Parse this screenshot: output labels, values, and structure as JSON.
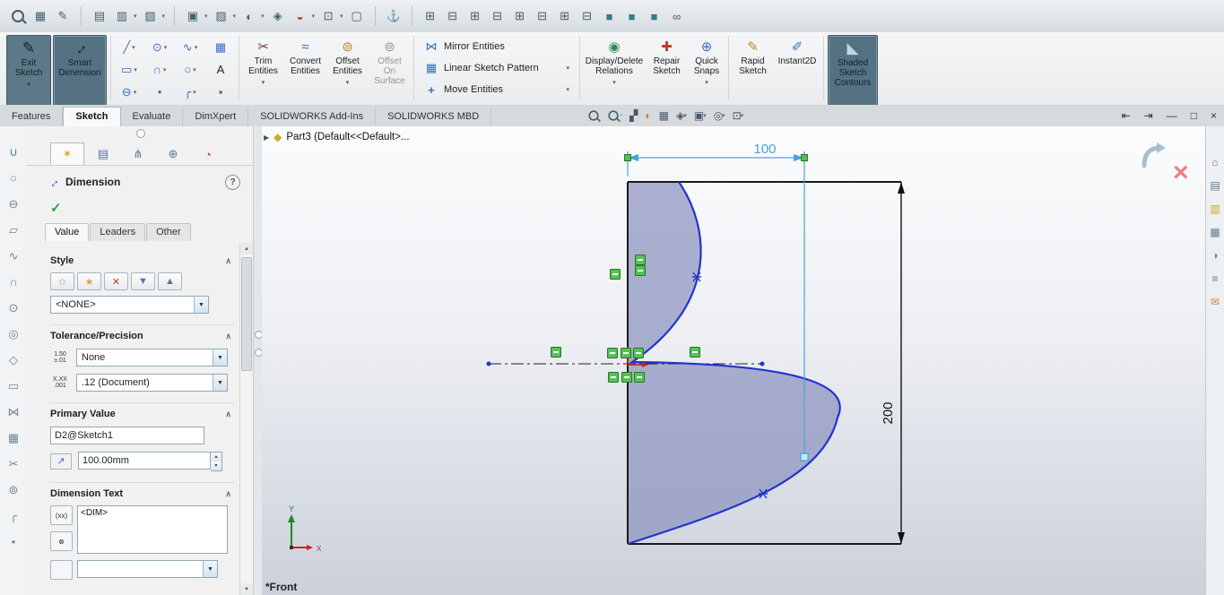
{
  "qat": {
    "icons": [
      {
        "name": "image-icon",
        "glyph": "▦"
      },
      {
        "name": "airbrush-icon",
        "glyph": "✎"
      },
      {
        "name": "stamp-icon",
        "glyph": "▤"
      },
      {
        "name": "print-icon",
        "glyph": "▥"
      },
      {
        "name": "save-icon",
        "glyph": "▧"
      },
      {
        "name": "view-cube-icon",
        "glyph": "▣"
      },
      {
        "name": "pattern-cube-icon",
        "glyph": "▨"
      },
      {
        "name": "appearance-sphere-icon",
        "glyph": "◐"
      },
      {
        "name": "scene-icon",
        "glyph": "◈"
      },
      {
        "name": "material-icon",
        "glyph": "◒"
      },
      {
        "name": "monitor-icon",
        "glyph": "⊡"
      },
      {
        "name": "wire-cube-icon",
        "glyph": "▢"
      },
      {
        "name": "anchor-icon",
        "glyph": "⚓"
      },
      {
        "name": "window-layout-1",
        "glyph": "⊞"
      },
      {
        "name": "window-layout-2",
        "glyph": "⊟"
      },
      {
        "name": "window-layout-3",
        "glyph": "⊞"
      },
      {
        "name": "window-layout-4",
        "glyph": "⊟"
      },
      {
        "name": "window-layout-5",
        "glyph": "⊞"
      },
      {
        "name": "window-layout-6",
        "glyph": "⊟"
      },
      {
        "name": "window-layout-7",
        "glyph": "⊞"
      },
      {
        "name": "window-layout-8",
        "glyph": "⊟"
      },
      {
        "name": "primitive-cube-1",
        "glyph": "■"
      },
      {
        "name": "primitive-cube-2",
        "glyph": "■"
      },
      {
        "name": "primitive-cube-3",
        "glyph": "■"
      },
      {
        "name": "attachment-icon",
        "glyph": "∞"
      }
    ]
  },
  "cmd": {
    "exit_sketch": "Exit\nSketch",
    "exit_icon": "✎",
    "smart_dimension": "Smart\nDimension",
    "smartdim_icon": "↔",
    "tools": [
      {
        "glyph": "╱"
      },
      {
        "glyph": "⊙"
      },
      {
        "glyph": "∿"
      },
      {
        "glyph": "▦"
      },
      {
        "glyph": "▭"
      },
      {
        "glyph": "∩"
      },
      {
        "glyph": "○"
      },
      {
        "glyph": "A"
      },
      {
        "glyph": "⊖"
      },
      {
        "glyph": "•"
      },
      {
        "glyph": "╭"
      },
      {
        "glyph": "▪"
      }
    ],
    "trim": "Trim\nEntities",
    "trim_icon": "✂",
    "convert": "Convert\nEntities",
    "convert_icon": "≈",
    "offset": "Offset\nEntities",
    "offset_icon": "⊚",
    "offset_surface": "Offset\nOn\nSurface",
    "offset_surface_icon": "⊚",
    "mirror": "Mirror Entities",
    "mirror_icon": "⋈",
    "linear_pattern": "Linear Sketch Pattern",
    "pattern_icon": "▦",
    "move": "Move Entities",
    "move_icon": "+",
    "display_delete": "Display/Delete\nRelations",
    "display_icon": "◉",
    "repair": "Repair\nSketch",
    "repair_icon": "✚",
    "quick_snaps": "Quick\nSnaps",
    "snaps_icon": "⊕",
    "rapid": "Rapid\nSketch",
    "rapid_icon": "✎",
    "instant2d": "Instant2D",
    "instant_icon": "✐",
    "shaded": "Shaded\nSketch\nContours",
    "shaded_icon": "◣"
  },
  "window": {
    "tabs": [
      {
        "label": "Features"
      },
      {
        "label": "Sketch"
      },
      {
        "label": "Evaluate"
      },
      {
        "label": "DimXpert"
      },
      {
        "label": "SOLIDWORKS Add-Ins"
      },
      {
        "label": "SOLIDWORKS MBD"
      }
    ],
    "controls": [
      {
        "name": "collapse-left-pane",
        "glyph": "⇤"
      },
      {
        "name": "collapse-right-pane",
        "glyph": "⇥"
      },
      {
        "name": "minimize",
        "glyph": "—"
      },
      {
        "name": "restore",
        "glyph": "□"
      },
      {
        "name": "close",
        "glyph": "×"
      }
    ]
  },
  "headsup": {
    "icons": [
      {
        "name": "zoom-fit-icon",
        "glyph": ""
      },
      {
        "name": "zoom-area-icon",
        "glyph": ""
      },
      {
        "name": "section-view-icon",
        "glyph": "▞"
      },
      {
        "name": "edit-appearance-icon",
        "glyph": "◐"
      },
      {
        "name": "apply-scene-icon",
        "glyph": "▦"
      },
      {
        "name": "display-style-icon",
        "glyph": "◈",
        "dd": "▾"
      },
      {
        "name": "view-orientation-icon",
        "glyph": "▣",
        "dd": "▾"
      },
      {
        "name": "hide-show-icon",
        "glyph": "◎",
        "dd": "▾"
      },
      {
        "name": "view-settings-icon",
        "glyph": "⊡",
        "dd": "▾"
      }
    ]
  },
  "tree": {
    "root": "Part3 (Default<<Default>...",
    "expander": "▶",
    "icon": "◆"
  },
  "pm": {
    "title": "Dimension",
    "help": "?",
    "ok": "✓",
    "tab_icons": [
      {
        "name": "propertymanager-tab",
        "glyph": "✶"
      },
      {
        "name": "custom-pane-tab",
        "glyph": "▤"
      },
      {
        "name": "tree-pane-tab",
        "glyph": "⋔"
      },
      {
        "name": "dimxpert-pane-tab",
        "glyph": "⊕"
      },
      {
        "name": "display-pane-tab",
        "glyph": "◔"
      }
    ],
    "tabs": [
      {
        "label": "Value"
      },
      {
        "label": "Leaders"
      },
      {
        "label": "Other"
      }
    ],
    "chevron": "∧",
    "style": {
      "header": "Style",
      "value": "<NONE>",
      "buttons": [
        {
          "name": "no-style-button",
          "glyph": "☆"
        },
        {
          "name": "add-style-button",
          "glyph": "★"
        },
        {
          "name": "delete-style-button",
          "glyph": "✕"
        },
        {
          "name": "save-style-button",
          "glyph": "▼"
        },
        {
          "name": "load-style-button",
          "glyph": "▲"
        }
      ]
    },
    "tolerance": {
      "header": "Tolerance/Precision",
      "type": "None",
      "precision": ".12 (Document)",
      "tol_icon": "1.50\n±.01",
      "prec_icon": "X.XX\n.001"
    },
    "primary": {
      "header": "Primary Value",
      "name": "D2@Sketch1",
      "value": "100.00mm",
      "override_icon": "↗"
    },
    "dim_text": {
      "header": "Dimension Text",
      "value": "<DIM>",
      "icon1": "(xx)",
      "icon2": "⊗"
    }
  },
  "viewport": {
    "dim_width": "100",
    "dim_height": "200",
    "view_label": "*Front",
    "triad": {
      "x": "X",
      "y": "Y"
    }
  },
  "left_toolbar": {
    "icons": [
      {
        "name": "magnet-tool-icon",
        "glyph": "∪"
      },
      {
        "name": "circle-tool-icon",
        "glyph": "○"
      },
      {
        "name": "ellipse-tool-icon",
        "glyph": "⊖"
      },
      {
        "name": "parallelogram-tool-icon",
        "glyph": "▱"
      },
      {
        "name": "spline-tool-icon",
        "glyph": "∿"
      },
      {
        "name": "arc-tool-icon",
        "glyph": "∩"
      },
      {
        "name": "perimeter-circle-icon",
        "glyph": "⊙"
      },
      {
        "name": "ring-tool-icon",
        "glyph": "◎"
      },
      {
        "name": "polygon-tool-icon",
        "glyph": "◇"
      },
      {
        "name": "rectangle-tool-icon",
        "glyph": "▭"
      },
      {
        "name": "mirror-tool-icon",
        "glyph": "⋈"
      },
      {
        "name": "pattern-tool-icon",
        "glyph": "▦"
      },
      {
        "name": "trim-tool-icon",
        "glyph": "✂"
      },
      {
        "name": "offset-tool-icon",
        "glyph": "⊚"
      },
      {
        "name": "fillet-tool-icon",
        "glyph": "╭"
      },
      {
        "name": "point-tool-icon",
        "glyph": "•"
      }
    ]
  },
  "taskpane": {
    "icons": [
      {
        "name": "home-icon",
        "glyph": "⌂",
        "color": "#b06040"
      },
      {
        "name": "design-library-icon",
        "glyph": "▤",
        "color": "#5b7a94"
      },
      {
        "name": "file-explorer-icon",
        "glyph": "▥",
        "color": "#caa22c"
      },
      {
        "name": "view-palette-icon",
        "glyph": "▦",
        "color": "#5b7a94"
      },
      {
        "name": "appearances-icon",
        "glyph": "◑",
        "color": "#4a90c4"
      },
      {
        "name": "custom-properties-icon",
        "glyph": "≡",
        "color": "#5b7a94"
      },
      {
        "name": "forum-icon",
        "glyph": "✉",
        "color": "#c58a3a"
      }
    ]
  }
}
